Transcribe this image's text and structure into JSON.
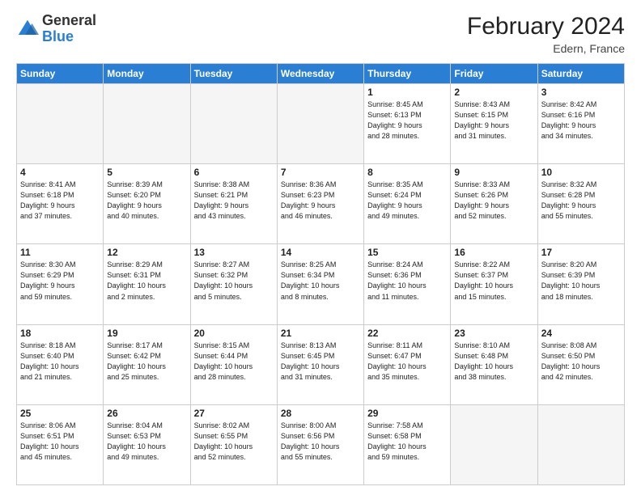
{
  "header": {
    "logo_general": "General",
    "logo_blue": "Blue",
    "month_year": "February 2024",
    "location": "Edern, France"
  },
  "days_of_week": [
    "Sunday",
    "Monday",
    "Tuesday",
    "Wednesday",
    "Thursday",
    "Friday",
    "Saturday"
  ],
  "weeks": [
    [
      {
        "day": "",
        "info": ""
      },
      {
        "day": "",
        "info": ""
      },
      {
        "day": "",
        "info": ""
      },
      {
        "day": "",
        "info": ""
      },
      {
        "day": "1",
        "info": "Sunrise: 8:45 AM\nSunset: 6:13 PM\nDaylight: 9 hours\nand 28 minutes."
      },
      {
        "day": "2",
        "info": "Sunrise: 8:43 AM\nSunset: 6:15 PM\nDaylight: 9 hours\nand 31 minutes."
      },
      {
        "day": "3",
        "info": "Sunrise: 8:42 AM\nSunset: 6:16 PM\nDaylight: 9 hours\nand 34 minutes."
      }
    ],
    [
      {
        "day": "4",
        "info": "Sunrise: 8:41 AM\nSunset: 6:18 PM\nDaylight: 9 hours\nand 37 minutes."
      },
      {
        "day": "5",
        "info": "Sunrise: 8:39 AM\nSunset: 6:20 PM\nDaylight: 9 hours\nand 40 minutes."
      },
      {
        "day": "6",
        "info": "Sunrise: 8:38 AM\nSunset: 6:21 PM\nDaylight: 9 hours\nand 43 minutes."
      },
      {
        "day": "7",
        "info": "Sunrise: 8:36 AM\nSunset: 6:23 PM\nDaylight: 9 hours\nand 46 minutes."
      },
      {
        "day": "8",
        "info": "Sunrise: 8:35 AM\nSunset: 6:24 PM\nDaylight: 9 hours\nand 49 minutes."
      },
      {
        "day": "9",
        "info": "Sunrise: 8:33 AM\nSunset: 6:26 PM\nDaylight: 9 hours\nand 52 minutes."
      },
      {
        "day": "10",
        "info": "Sunrise: 8:32 AM\nSunset: 6:28 PM\nDaylight: 9 hours\nand 55 minutes."
      }
    ],
    [
      {
        "day": "11",
        "info": "Sunrise: 8:30 AM\nSunset: 6:29 PM\nDaylight: 9 hours\nand 59 minutes."
      },
      {
        "day": "12",
        "info": "Sunrise: 8:29 AM\nSunset: 6:31 PM\nDaylight: 10 hours\nand 2 minutes."
      },
      {
        "day": "13",
        "info": "Sunrise: 8:27 AM\nSunset: 6:32 PM\nDaylight: 10 hours\nand 5 minutes."
      },
      {
        "day": "14",
        "info": "Sunrise: 8:25 AM\nSunset: 6:34 PM\nDaylight: 10 hours\nand 8 minutes."
      },
      {
        "day": "15",
        "info": "Sunrise: 8:24 AM\nSunset: 6:36 PM\nDaylight: 10 hours\nand 11 minutes."
      },
      {
        "day": "16",
        "info": "Sunrise: 8:22 AM\nSunset: 6:37 PM\nDaylight: 10 hours\nand 15 minutes."
      },
      {
        "day": "17",
        "info": "Sunrise: 8:20 AM\nSunset: 6:39 PM\nDaylight: 10 hours\nand 18 minutes."
      }
    ],
    [
      {
        "day": "18",
        "info": "Sunrise: 8:18 AM\nSunset: 6:40 PM\nDaylight: 10 hours\nand 21 minutes."
      },
      {
        "day": "19",
        "info": "Sunrise: 8:17 AM\nSunset: 6:42 PM\nDaylight: 10 hours\nand 25 minutes."
      },
      {
        "day": "20",
        "info": "Sunrise: 8:15 AM\nSunset: 6:44 PM\nDaylight: 10 hours\nand 28 minutes."
      },
      {
        "day": "21",
        "info": "Sunrise: 8:13 AM\nSunset: 6:45 PM\nDaylight: 10 hours\nand 31 minutes."
      },
      {
        "day": "22",
        "info": "Sunrise: 8:11 AM\nSunset: 6:47 PM\nDaylight: 10 hours\nand 35 minutes."
      },
      {
        "day": "23",
        "info": "Sunrise: 8:10 AM\nSunset: 6:48 PM\nDaylight: 10 hours\nand 38 minutes."
      },
      {
        "day": "24",
        "info": "Sunrise: 8:08 AM\nSunset: 6:50 PM\nDaylight: 10 hours\nand 42 minutes."
      }
    ],
    [
      {
        "day": "25",
        "info": "Sunrise: 8:06 AM\nSunset: 6:51 PM\nDaylight: 10 hours\nand 45 minutes."
      },
      {
        "day": "26",
        "info": "Sunrise: 8:04 AM\nSunset: 6:53 PM\nDaylight: 10 hours\nand 49 minutes."
      },
      {
        "day": "27",
        "info": "Sunrise: 8:02 AM\nSunset: 6:55 PM\nDaylight: 10 hours\nand 52 minutes."
      },
      {
        "day": "28",
        "info": "Sunrise: 8:00 AM\nSunset: 6:56 PM\nDaylight: 10 hours\nand 55 minutes."
      },
      {
        "day": "29",
        "info": "Sunrise: 7:58 AM\nSunset: 6:58 PM\nDaylight: 10 hours\nand 59 minutes."
      },
      {
        "day": "",
        "info": ""
      },
      {
        "day": "",
        "info": ""
      }
    ]
  ]
}
